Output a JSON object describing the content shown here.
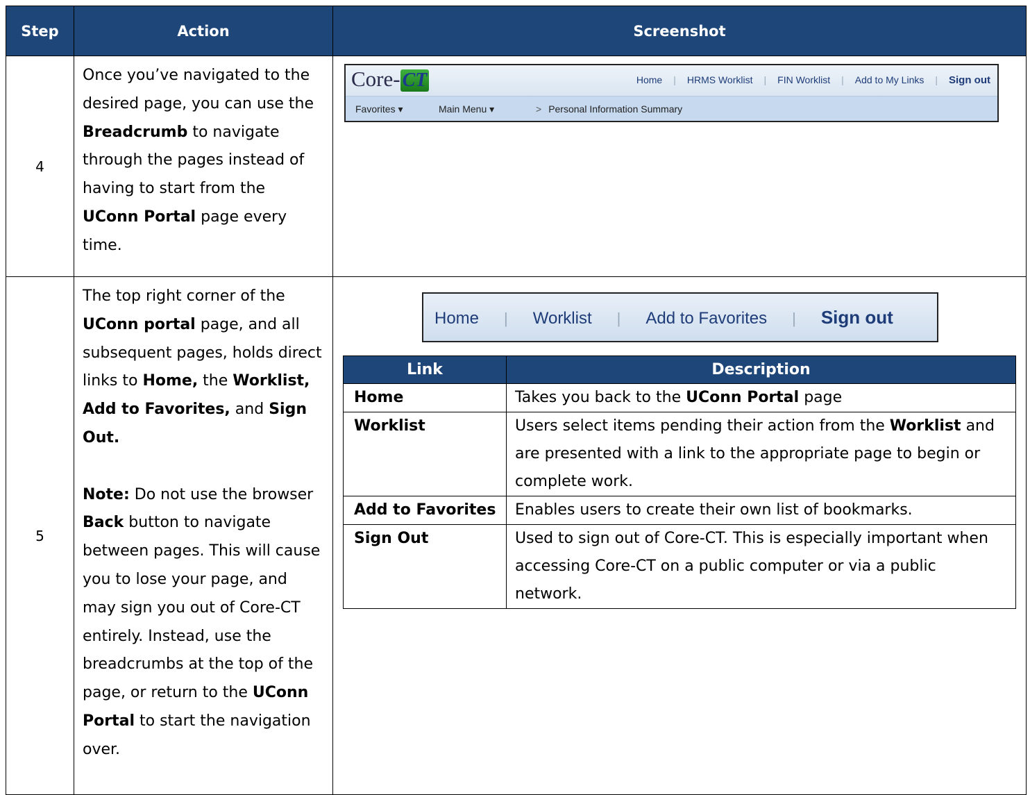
{
  "header": {
    "step": "Step",
    "action": "Action",
    "screenshot": "Screenshot"
  },
  "row4": {
    "step": "4",
    "action": {
      "t1": "Once you’ve navigated to the desired page, you can use the ",
      "b1": "Breadcrumb",
      "t2": " to navigate through the pages instead of having to start from the ",
      "b2": "UConn Portal",
      "t3": " page every time."
    },
    "screenshot": {
      "logo_text": "Core-",
      "logo_ct": "CT",
      "links": [
        "Home",
        "HRMS Worklist",
        "FIN Worklist",
        "Add to My Links"
      ],
      "signout": "Sign out",
      "favorites": "Favorites ▾",
      "main_menu": "Main Menu ▾",
      "chevron": ">",
      "breadcrumb_page": "Personal Information Summary"
    }
  },
  "row5": {
    "step": "5",
    "action": {
      "p1_t1": "The top right corner of the ",
      "p1_b1": "UConn portal",
      "p1_t2": " page, and all subsequent pages, holds direct links to ",
      "p1_b2": "Home,",
      "p1_t3": " the ",
      "p1_b3": "Worklist, Add to Favorites,",
      "p1_t4": " and ",
      "p1_b4": "Sign Out.",
      "p2_b1": "Note:",
      "p2_t1": " Do not use the browser ",
      "p2_b2": "Back",
      "p2_t2": " button to navigate between pages. This will cause you to lose your page, and may sign you out of Core-CT entirely. Instead, use the breadcrumbs at the top of the page, or return to the ",
      "p2_b3": "UConn Portal",
      "p2_t3": " to start the navigation over."
    },
    "linkbar": {
      "home": "Home",
      "worklist": "Worklist",
      "add_fav": "Add to Favorites",
      "signout": "Sign out"
    },
    "table": {
      "col_link": "Link",
      "col_desc": "Description",
      "rows": [
        {
          "link": "Home",
          "d1": "Takes you back to the ",
          "db": "UConn Portal",
          "d2": " page"
        },
        {
          "link": "Worklist",
          "d1": "Users select items pending their action from the ",
          "db": "Worklist",
          "d2": " and are presented with a link to the appropriate page to begin or complete work."
        },
        {
          "link": "Add to Favorites",
          "d1": "Enables users to create their own list of bookmarks.",
          "db": "",
          "d2": ""
        },
        {
          "link": "Sign Out",
          "d1": "Used to sign out of Core-CT. This is especially important when accessing Core-CT on a public computer or via a public network.",
          "db": "",
          "d2": ""
        }
      ]
    }
  }
}
